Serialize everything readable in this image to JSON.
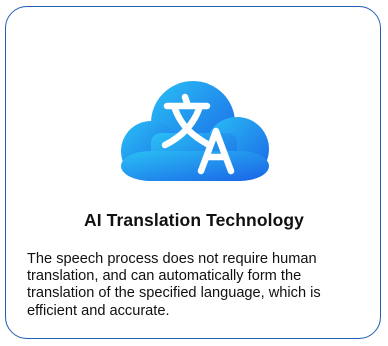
{
  "card": {
    "icon": "translation-cloud-icon",
    "title": "AI Translation Technology",
    "description": "The speech process does not require human translation, and can automatically form the translation of the specified language, which is efficient and accurate."
  },
  "colors": {
    "border": "#1f5fb4",
    "cloud_gradient_start": "#2ac0f5",
    "cloud_gradient_end": "#1a63e6",
    "text": "#111111"
  }
}
